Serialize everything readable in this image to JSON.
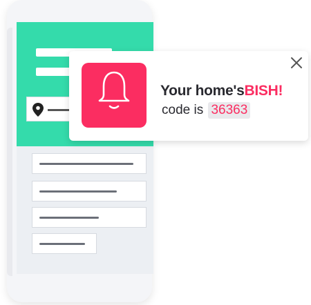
{
  "notification": {
    "message_prefix": "Your home's",
    "brand": "BISH!",
    "code_label": "code is",
    "code": "36363"
  },
  "icons": {
    "bell": "bell-icon",
    "close": "close-icon",
    "location": "location-pin-icon"
  },
  "colors": {
    "accent": "#fb2d61",
    "header": "#34dbab",
    "dots": "#5ee0d4"
  }
}
